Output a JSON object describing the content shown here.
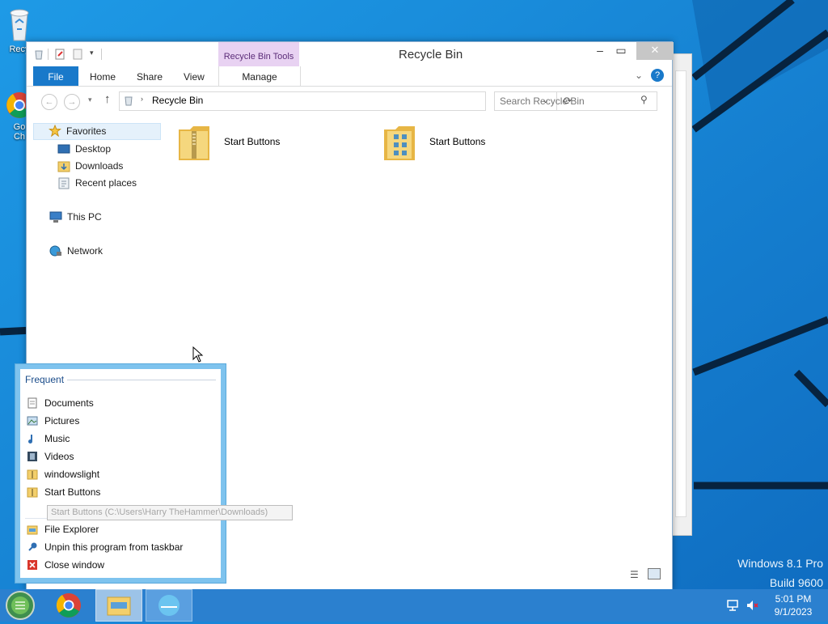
{
  "desktop": {
    "icons": [
      {
        "label": "Recy",
        "icon": "recycle-bin-icon"
      },
      {
        "label_line1": "Go",
        "label_line2": "Ch",
        "icon": "chrome-icon"
      }
    ],
    "watermark": {
      "line1": "Windows 8.1 Pro",
      "line2": "Build 9600"
    }
  },
  "explorer": {
    "title": "Recycle Bin",
    "tools_tab": "Recycle Bin Tools",
    "ribbon": {
      "file": "File",
      "home": "Home",
      "share": "Share",
      "view": "View",
      "manage": "Manage"
    },
    "address": {
      "location": "Recycle Bin"
    },
    "search": {
      "placeholder": "Search Recycle Bin"
    },
    "nav": {
      "favorites": "Favorites",
      "desktop": "Desktop",
      "downloads": "Downloads",
      "recent": "Recent places",
      "this_pc": "This PC",
      "network": "Network"
    },
    "files": [
      {
        "name": "Start Buttons",
        "icon": "zip-folder-icon"
      },
      {
        "name": "Start Buttons",
        "icon": "folder-icon"
      }
    ]
  },
  "jumplist": {
    "header": "Frequent",
    "frequent": [
      {
        "label": "Documents",
        "icon": "documents-icon"
      },
      {
        "label": "Pictures",
        "icon": "pictures-icon"
      },
      {
        "label": "Music",
        "icon": "music-icon"
      },
      {
        "label": "Videos",
        "icon": "videos-icon"
      },
      {
        "label": "windowslight",
        "icon": "folder-icon"
      },
      {
        "label": "Start Buttons",
        "icon": "folder-icon"
      }
    ],
    "tasks": {
      "file_explorer": "File Explorer",
      "unpin": "Unpin this program from taskbar",
      "close": "Close window"
    },
    "tooltip": "Start Buttons (C:\\Users\\Harry TheHammer\\Downloads)"
  },
  "taskbar": {
    "time": "5:01 PM",
    "date": "9/1/2023"
  },
  "colors": {
    "accent": "#1979ca",
    "taskbar": "#2b80cf",
    "tools_tab": "#e8d2f2",
    "desktop": "#1a86d8"
  }
}
